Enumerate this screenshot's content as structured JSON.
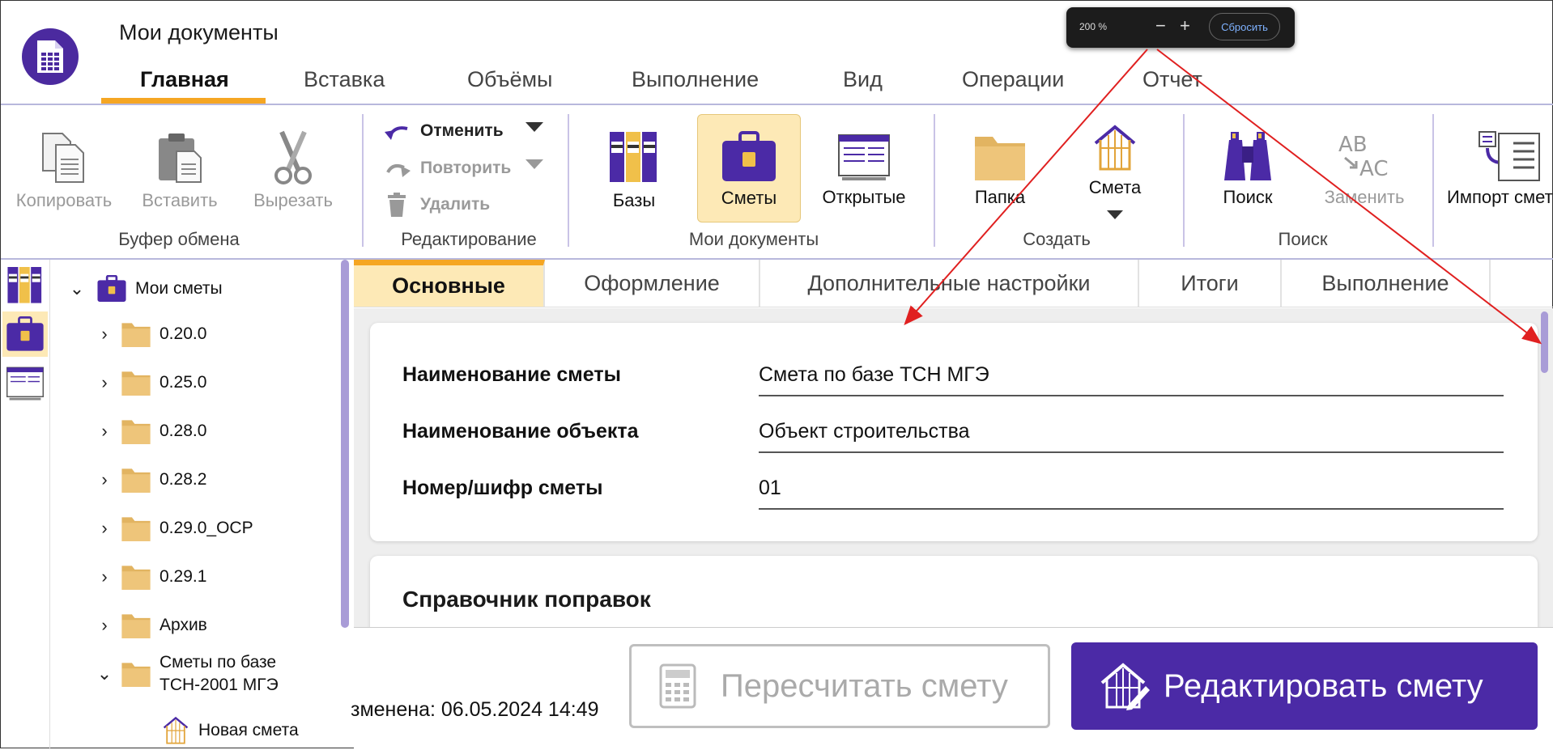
{
  "header": {
    "app_title": "Мои документы",
    "tabs": [
      {
        "label": "Главная",
        "active": true
      },
      {
        "label": "Вставка"
      },
      {
        "label": "Объёмы"
      },
      {
        "label": "Выполнение"
      },
      {
        "label": "Вид"
      },
      {
        "label": "Операции"
      },
      {
        "label": "Отчет"
      }
    ],
    "accent_color": "#f5a623",
    "brand_color": "#4b2aa6"
  },
  "zoom_popup": {
    "level": "200 %",
    "minus": "−",
    "plus": "+",
    "reset_label": "Сбросить"
  },
  "ribbon": {
    "clipboard": {
      "label": "Буфер обмена",
      "copy": "Копировать",
      "paste": "Вставить",
      "cut": "Вырезать"
    },
    "editing": {
      "label": "Редактирование",
      "undo": "Отменить",
      "redo": "Повторить",
      "delete": "Удалить"
    },
    "my_docs": {
      "label": "Мои документы",
      "bases": "Базы",
      "estimates": "Сметы",
      "open": "Открытые"
    },
    "create": {
      "label": "Создать",
      "folder": "Папка",
      "estimate": "Смета"
    },
    "search": {
      "label": "Поиск",
      "find": "Поиск",
      "replace": "Заменить",
      "import": "Импорт смет"
    }
  },
  "tree": {
    "root": "Мои сметы",
    "items": [
      {
        "label": "0.20.0"
      },
      {
        "label": "0.25.0"
      },
      {
        "label": "0.28.0"
      },
      {
        "label": "0.28.2"
      },
      {
        "label": "0.29.0_ОСР"
      },
      {
        "label": "0.29.1"
      },
      {
        "label": "Архив"
      },
      {
        "label": "Сметы по базе ТСН-2001 МГЭ",
        "line1": "Сметы по базе",
        "line2": "ТСН-2001 МГЭ"
      }
    ],
    "child": "Новая смета"
  },
  "content_tabs": [
    {
      "label": "Основные",
      "active": true
    },
    {
      "label": "Оформление"
    },
    {
      "label": "Дополнительные настройки"
    },
    {
      "label": "Итоги"
    },
    {
      "label": "Выполнение"
    }
  ],
  "form": {
    "name_label": "Наименование сметы",
    "name_value": "Смета по базе ТСН МГЭ",
    "object_label": "Наименование объекта",
    "object_value": "Объект строительства",
    "number_label": "Номер/шифр сметы",
    "number_value": "01",
    "section_title": "Справочник поправок"
  },
  "bottom": {
    "modified": "зменена: 06.05.2024 14:49",
    "recalc": "Пересчитать смету",
    "edit": "Редактировать смету"
  }
}
